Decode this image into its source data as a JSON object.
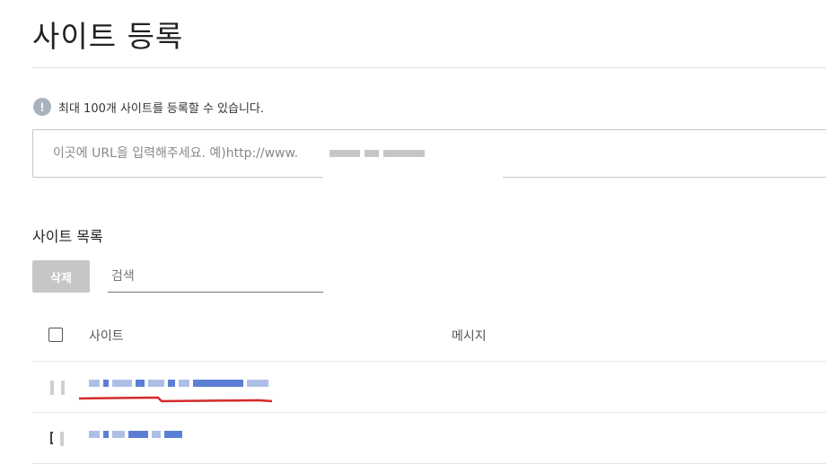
{
  "page": {
    "title": "사이트 등록"
  },
  "notice": {
    "icon": "info-icon",
    "text": "최대 100개 사이트를 등록할 수 있습니다."
  },
  "url_input": {
    "value": "",
    "placeholder": "이곳에 URL을 입력해주세요. 예)http://www."
  },
  "site_list": {
    "title": "사이트 목록",
    "delete_label": "삭제",
    "search_placeholder": "검색",
    "columns": {
      "site": "사이트",
      "message": "메시지"
    }
  },
  "colors": {
    "link": "#5b7fd4",
    "annotation": "#d42a2a",
    "disabled_button": "#c6c6c6",
    "info_icon": "#a9b3bd"
  }
}
